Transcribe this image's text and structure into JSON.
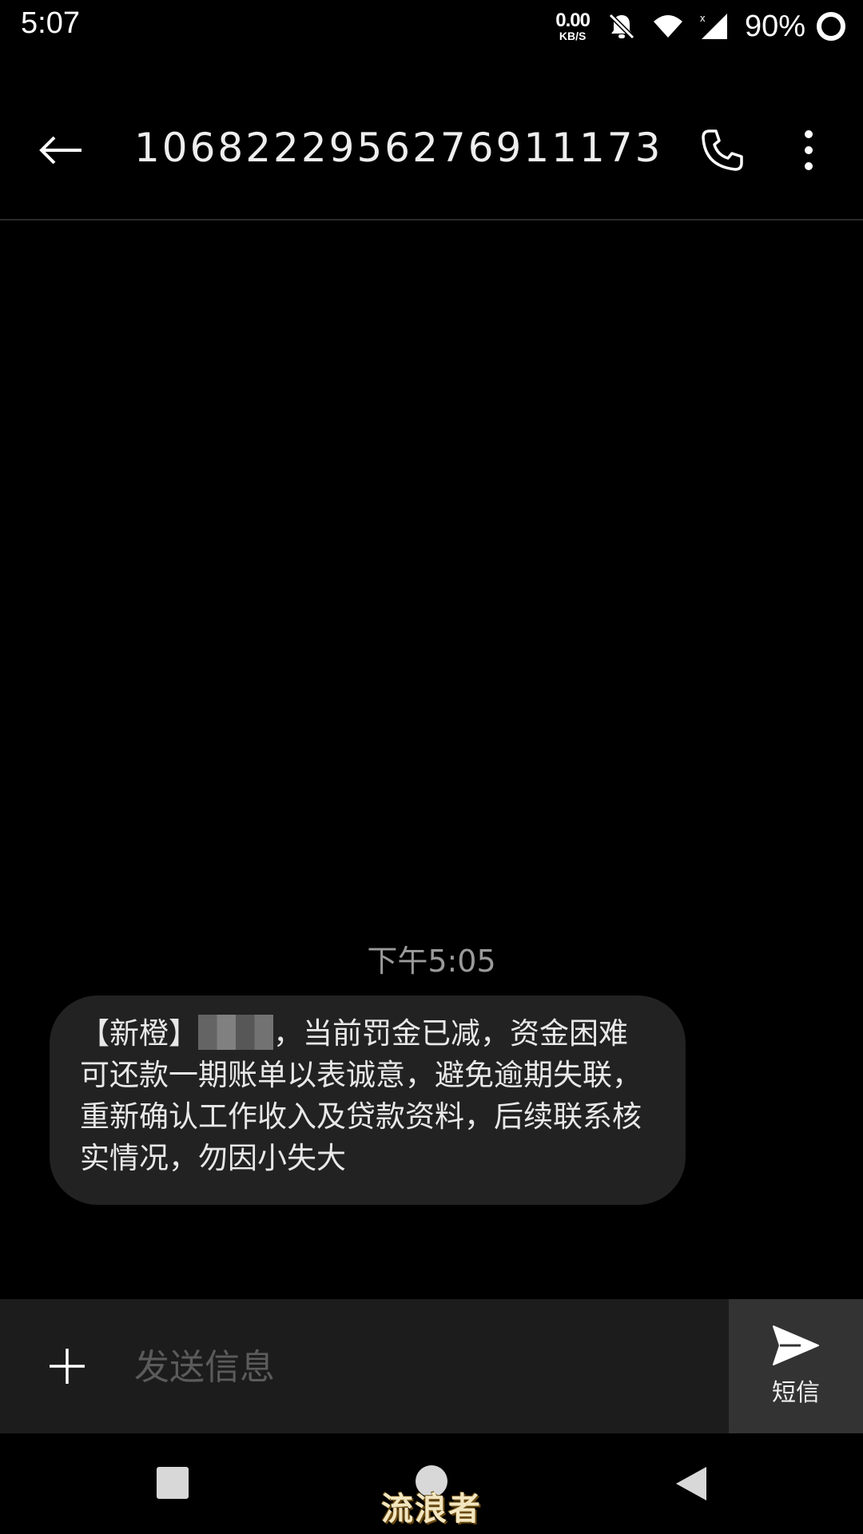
{
  "status_bar": {
    "time": "5:07",
    "net_speed_value": "0.00",
    "net_speed_unit": "KB/S",
    "battery_percent": "90%",
    "icons": [
      "bell-off-icon",
      "wifi-icon",
      "signal-icon",
      "battery-ring-icon"
    ]
  },
  "app_bar": {
    "contact": "1068222956276911173"
  },
  "conversation": {
    "timestamp": "下午5:05",
    "message": {
      "prefix": "【新橙】",
      "text": "，当前罚金已减，资金困难可还款一期账单以表诚意，避免逾期失联，重新确认工作收入及贷款资料，后续联系核实情况，勿因小失大"
    }
  },
  "compose": {
    "placeholder": "发送信息",
    "send_label": "短信"
  },
  "watermark": "流浪者",
  "colors": {
    "background": "#000000",
    "bubble": "#222222",
    "compose_bar": "#1c1c1c",
    "send_button": "#333333"
  }
}
